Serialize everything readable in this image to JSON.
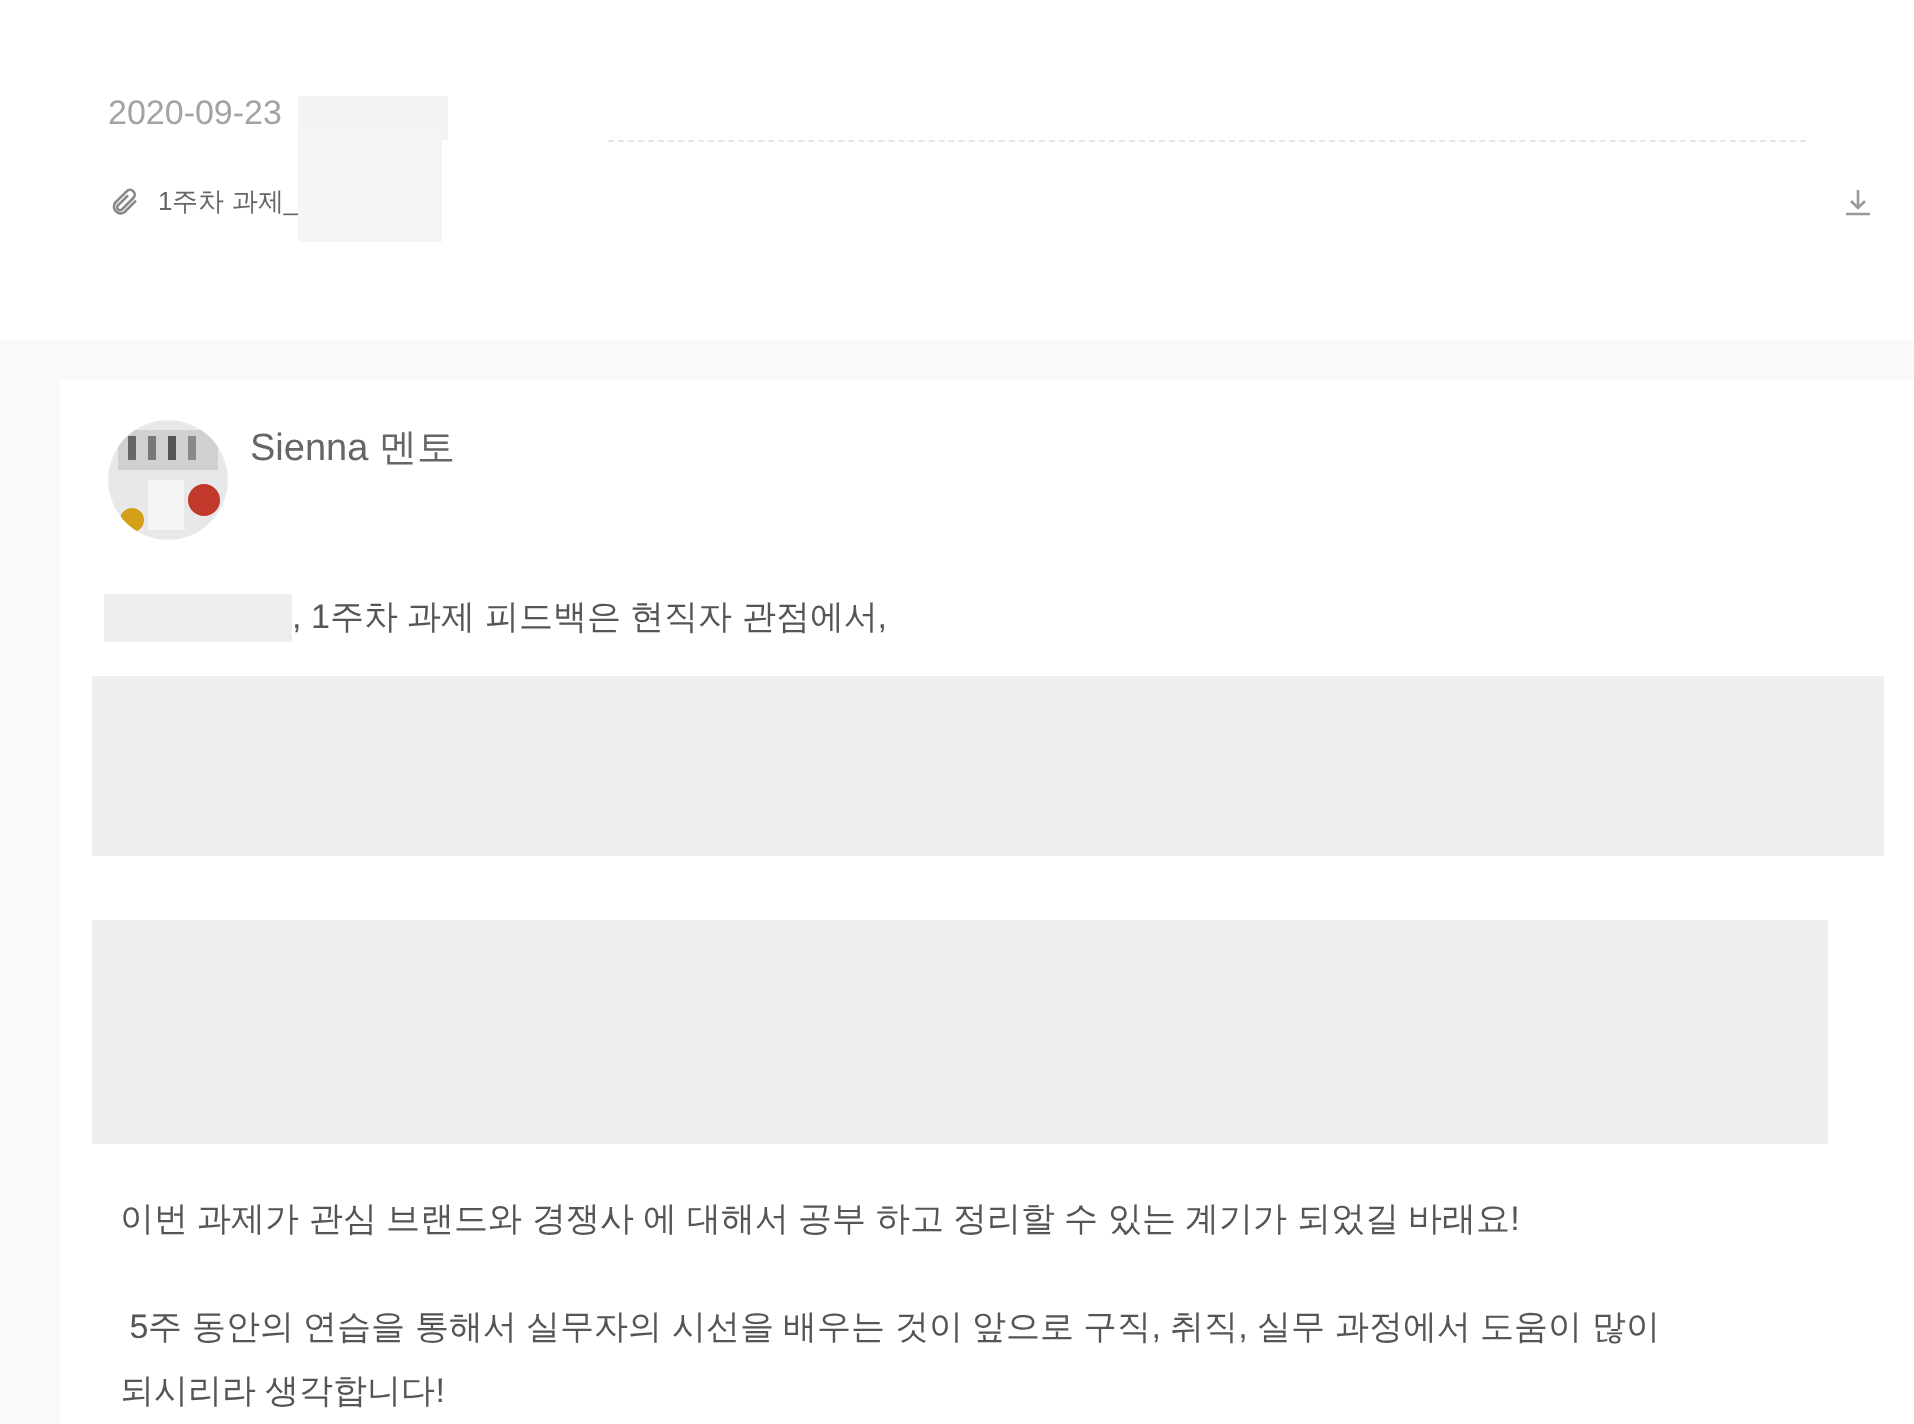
{
  "post": {
    "date": "2020-09-23",
    "attachment": {
      "name": "1주차 과제_"
    }
  },
  "comment": {
    "author": "Sienna 멘토",
    "greeting": ", 1주차 과제 피드백은 현직자 관점에서,",
    "paragraphs": [
      "이번 과제가 관심 브랜드와 경쟁사 에 대해서 공부 하고 정리할 수 있는 계기가 되었길 바래요!",
      " 5주 동안의 연습을 통해서 실무자의 시선을 배우는 것이 앞으로 구직, 취직, 실무 과정에서 도움이 많이 되시리라 생각합니다!"
    ]
  }
}
